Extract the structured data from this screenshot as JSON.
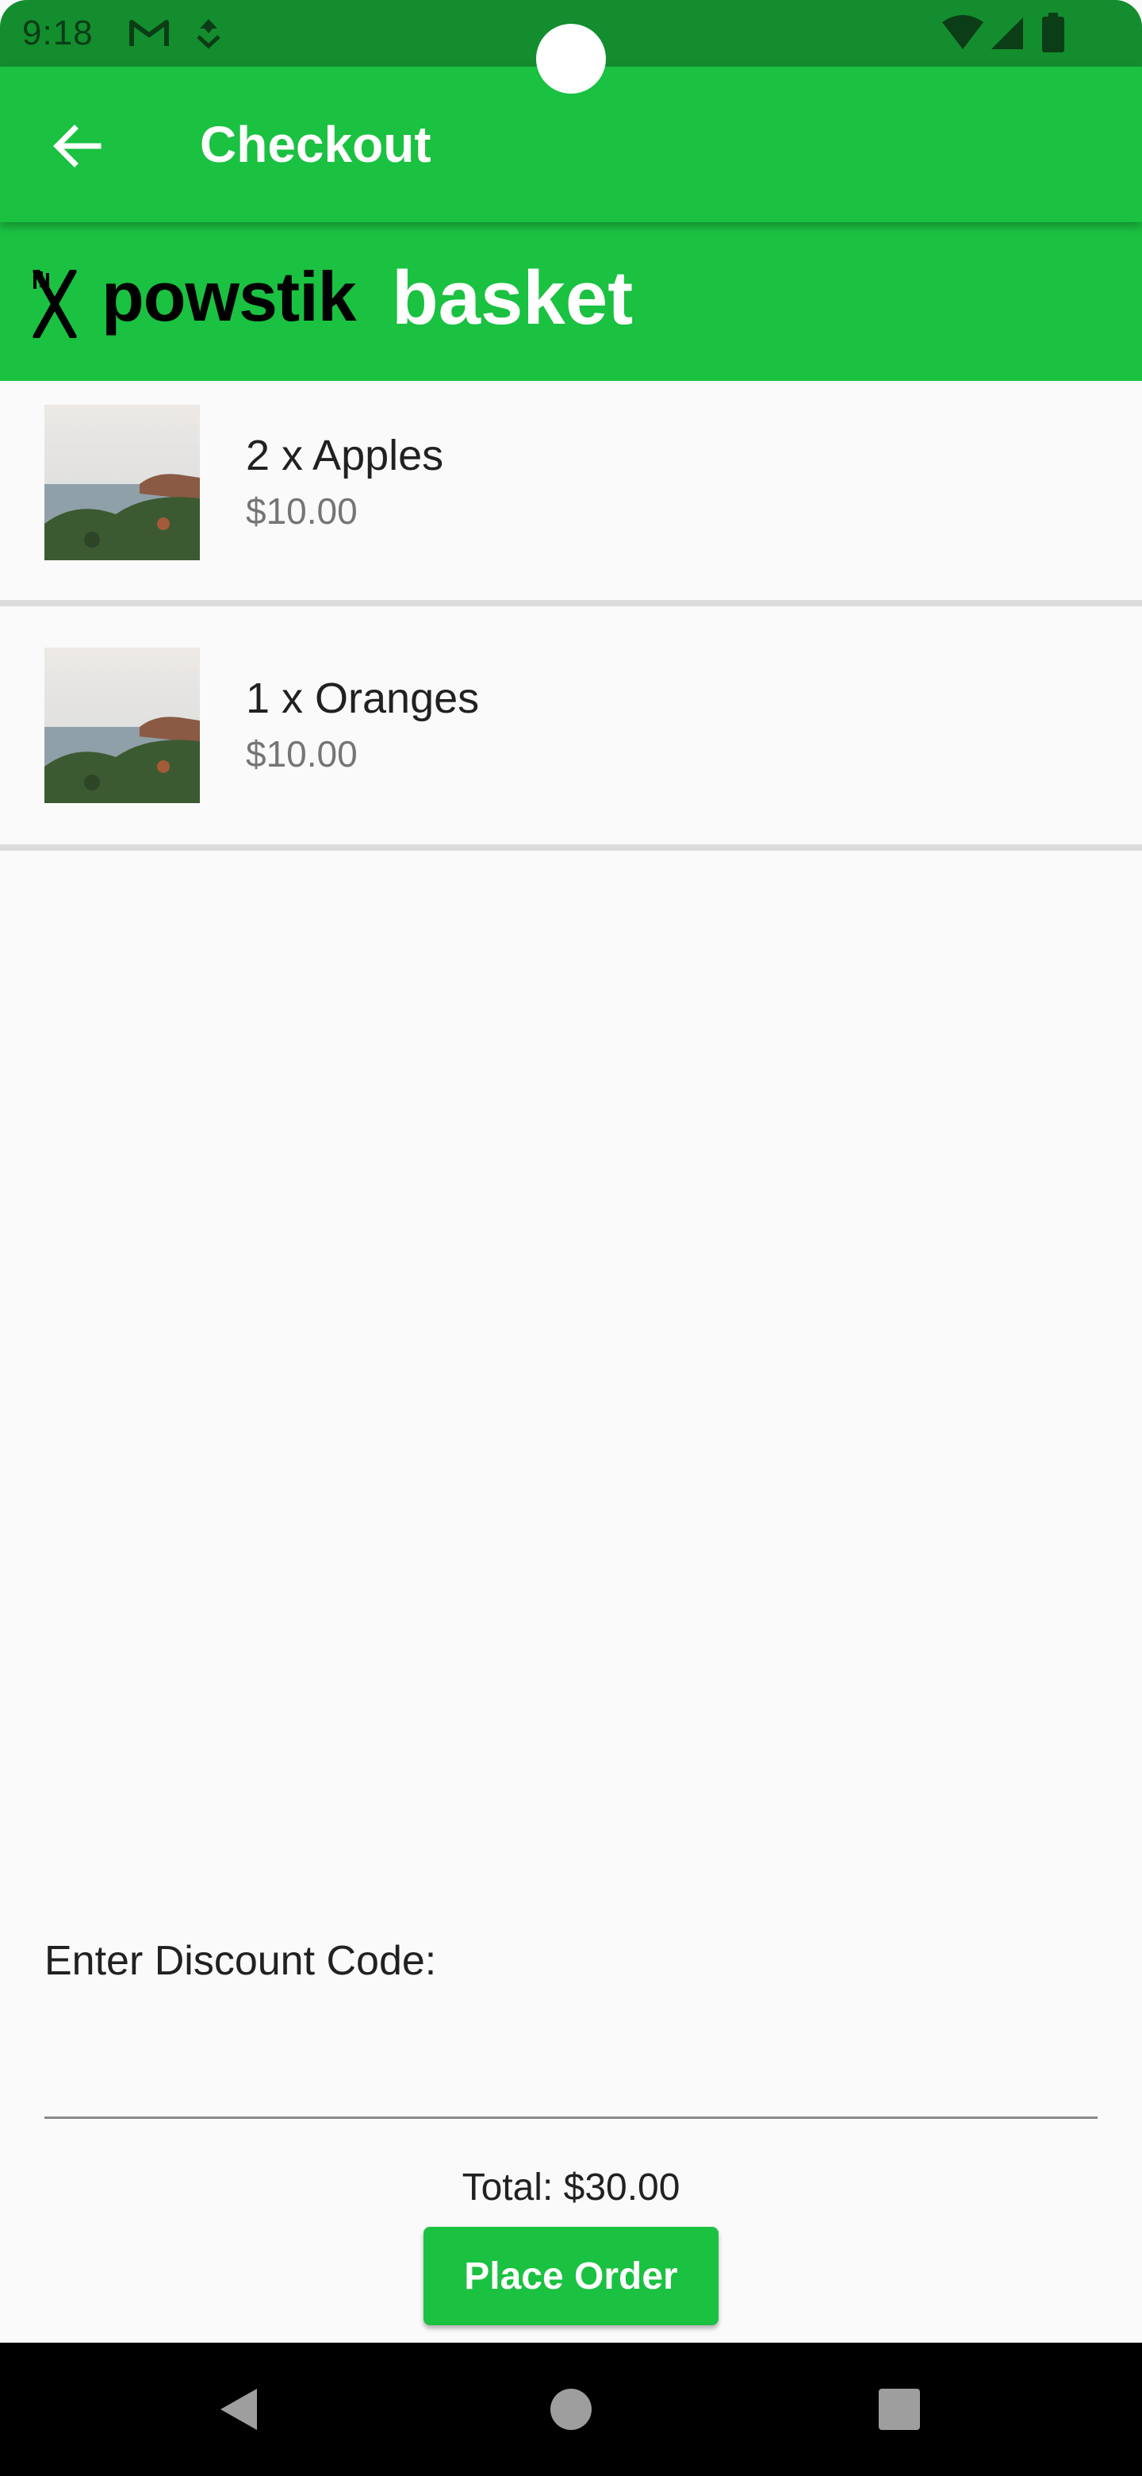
{
  "status_bar": {
    "time": "9:18",
    "icons": [
      "gmail-icon",
      "download-icon",
      "wifi-icon",
      "signal-icon",
      "battery-icon"
    ]
  },
  "app_bar": {
    "title": "Checkout",
    "back_icon": "arrow-back-icon"
  },
  "brand": {
    "logo_icon": "fork-knife-icon",
    "name": "powstik",
    "tagline": "basket"
  },
  "items": [
    {
      "title": "2 x Apples",
      "price": "$10.00",
      "thumbnail": "landscape-photo"
    },
    {
      "title": "1 x Oranges",
      "price": "$10.00",
      "thumbnail": "landscape-photo"
    }
  ],
  "discount": {
    "label": "Enter Discount Code:",
    "value": "",
    "placeholder": ""
  },
  "total": "Total: $30.00",
  "place_order_label": "Place Order",
  "nav_bar": [
    "back-triangle-icon",
    "home-circle-icon",
    "recents-square-icon"
  ],
  "colors": {
    "primary": "#1bc141",
    "status_bar": "#138d2e",
    "background": "#fafafa",
    "divider": "#dcdcdc",
    "secondary_text": "#757575"
  }
}
